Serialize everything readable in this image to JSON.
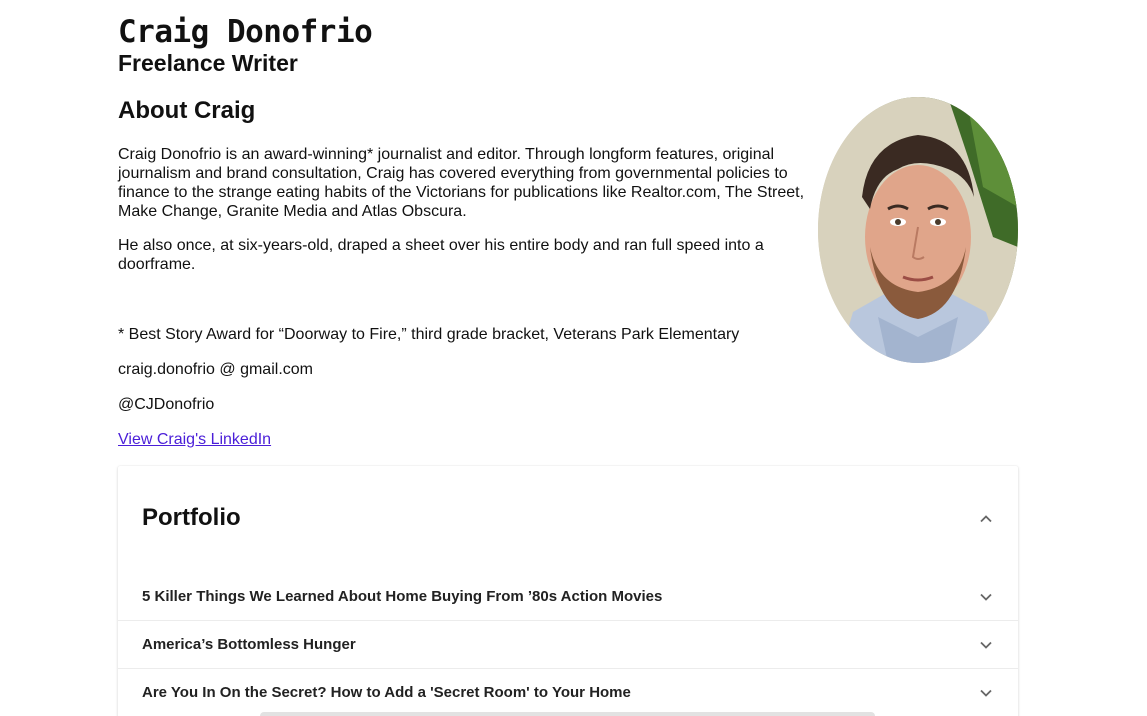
{
  "header": {
    "name": "Craig Donofrio",
    "subtitle": "Freelance Writer"
  },
  "about": {
    "heading": "About Craig",
    "paragraphs": [
      "Craig Donofrio is an award-winning* journalist and editor. Through longform features, original journalism and brand consultation, Craig has covered everything from governmental policies to finance to the strange eating habits of the Victorians for publications like Realtor.com, The Street, Make Change, Granite Media and Atlas Obscura.",
      "He also once, at six-years-old, draped a sheet over his entire body and ran full speed into a doorframe."
    ],
    "footnote": "* Best Story Award for “Doorway to Fire,” third grade bracket, Veterans Park Elementary",
    "email": "craig.donofrio @ gmail.com",
    "handle": "@CJDonofrio",
    "linkedin_label": "View Craig's LinkedIn"
  },
  "portfolio": {
    "title": "Portfolio",
    "items": [
      {
        "label": "5 Killer Things We Learned About Home Buying From ’80s Action Movies"
      },
      {
        "label": "America’s Bottomless Hunger"
      },
      {
        "label": "Are You In On the Secret? How to Add a 'Secret Room' to Your Home"
      }
    ]
  },
  "icons": {
    "expanded": "chevron-up-icon",
    "collapsed": "chevron-down-icon"
  },
  "colors": {
    "link": "#4a1ed8",
    "text": "#111111"
  }
}
